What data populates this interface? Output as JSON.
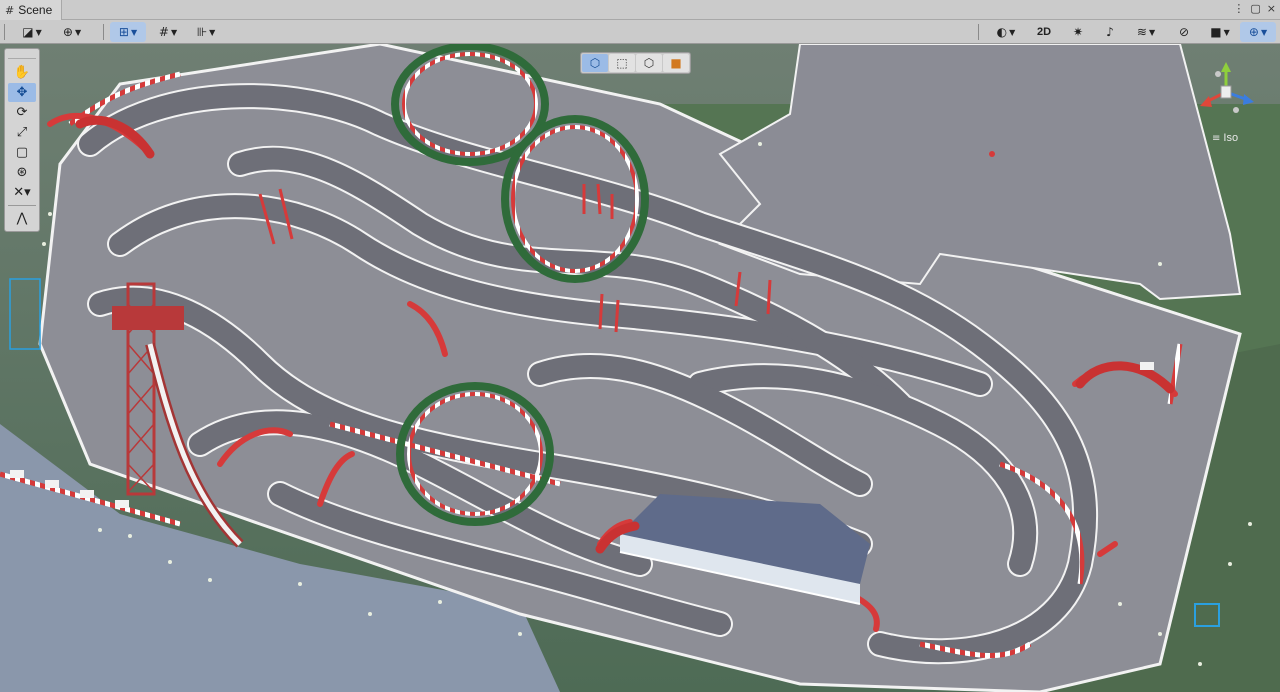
{
  "window": {
    "tab_title": "Scene",
    "tab_icon": "hash-icon",
    "controls": [
      "more-icon",
      "maximize-icon",
      "close-icon"
    ]
  },
  "toolbar": {
    "left": [
      {
        "name": "draw-mode-button",
        "icon": "shading-mode-icon"
      },
      {
        "name": "global-button",
        "icon": "globe-icon"
      },
      {
        "name": "move-snapping-button",
        "icon": "grid-snap-icon"
      },
      {
        "name": "grid-button",
        "icon": "grid-icon"
      },
      {
        "name": "increment-snapping-button",
        "icon": "ruler-icon"
      }
    ],
    "right": [
      {
        "name": "shading-sphere-button",
        "icon": "sphere-icon"
      },
      {
        "name": "toggle-2d-button",
        "label": "2D"
      },
      {
        "name": "lighting-button",
        "icon": "light-icon"
      },
      {
        "name": "audio-button",
        "icon": "audio-icon"
      },
      {
        "name": "effects-button",
        "icon": "layers-icon"
      },
      {
        "name": "hidden-objects-button",
        "icon": "eye-slash-icon"
      },
      {
        "name": "camera-button",
        "icon": "camera-icon"
      },
      {
        "name": "gizmos-button",
        "icon": "globe-gizmo-icon"
      }
    ],
    "toggle_2d_label": "2D"
  },
  "tools": {
    "items": [
      {
        "name": "hand-tool",
        "icon": "hand-icon",
        "active": false
      },
      {
        "name": "move-tool",
        "icon": "move-icon",
        "active": true
      },
      {
        "name": "rotate-tool",
        "icon": "rotate-icon",
        "active": false
      },
      {
        "name": "scale-tool",
        "icon": "scale-icon",
        "active": false
      },
      {
        "name": "rect-tool",
        "icon": "rect-icon",
        "active": false
      },
      {
        "name": "transform-tool",
        "icon": "transform-icon",
        "active": false
      },
      {
        "name": "custom-tool",
        "icon": "custom-tool-icon",
        "active": false
      },
      {
        "name": "path-tool",
        "icon": "path-icon",
        "active": false
      }
    ]
  },
  "view_modes": [
    {
      "name": "cube-view-button",
      "icon": "cube-icon",
      "active": true
    },
    {
      "name": "rect-view-button",
      "icon": "rect-view-icon",
      "active": false
    },
    {
      "name": "wire-cube-view-button",
      "icon": "wire-cube-icon",
      "active": false
    },
    {
      "name": "solid-cube-view-button",
      "icon": "orange-cube-icon",
      "active": false
    }
  ],
  "gizmo": {
    "projection_label": "Iso",
    "axis_colors": {
      "x": "#e0473a",
      "y": "#8fcf3c",
      "z": "#3a7de0"
    }
  },
  "scene": {
    "colors": {
      "terrain": "#5d7a58",
      "track": "#6e6f78",
      "track_line": "#f2f2f2",
      "kerb_red": "#d63a3a",
      "loop_green": "#2f6b3a",
      "roof": "#5f6b8a",
      "water": "#7f8ea3"
    }
  }
}
